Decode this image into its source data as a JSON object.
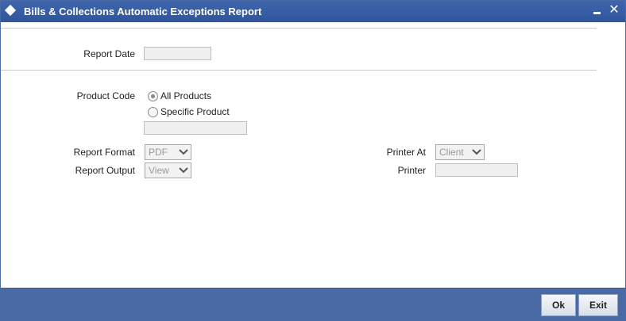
{
  "window": {
    "title": "Bills & Collections Automatic Exceptions Report",
    "minimize_glyph": "",
    "close_glyph": "✕"
  },
  "form": {
    "report_date": {
      "label": "Report Date",
      "value": ""
    },
    "product_code": {
      "label": "Product Code",
      "options": [
        "All Products",
        "Specific Product"
      ],
      "selected": "All Products",
      "specific_value": ""
    },
    "report_format": {
      "label": "Report Format",
      "value": "PDF"
    },
    "report_output": {
      "label": "Report Output",
      "value": "View"
    },
    "printer_at": {
      "label": "Printer At",
      "value": "Client"
    },
    "printer": {
      "label": "Printer",
      "value": ""
    }
  },
  "footer": {
    "ok_label": "Ok",
    "exit_label": "Exit"
  },
  "colors": {
    "titlebar": "#2f549c",
    "footer": "#4a6aa6"
  }
}
